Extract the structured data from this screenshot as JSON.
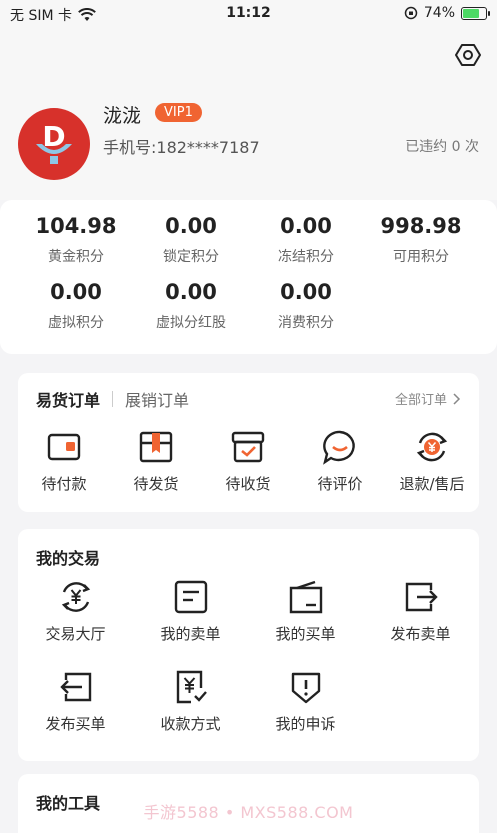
{
  "status_bar": {
    "carrier": "无 SIM 卡",
    "time": "11:12",
    "battery_percent": "74%",
    "battery_level": 0.74
  },
  "profile": {
    "avatar_letter": "D",
    "username": "泷泷",
    "vip_badge": "VIP1",
    "phone": "手机号:182****7187",
    "violations": "已违约 0 次"
  },
  "stats": [
    {
      "value": "104.98",
      "label": "黄金积分"
    },
    {
      "value": "0.00",
      "label": "锁定积分"
    },
    {
      "value": "0.00",
      "label": "冻结积分"
    },
    {
      "value": "998.98",
      "label": "可用积分"
    },
    {
      "value": "0.00",
      "label": "虚拟积分"
    },
    {
      "value": "0.00",
      "label": "虚拟分红股"
    },
    {
      "value": "0.00",
      "label": "消费积分"
    }
  ],
  "orders": {
    "tab_active": "易货订单",
    "tab_inactive": "展销订单",
    "all_orders": "全部订单",
    "items": [
      {
        "label": "待付款",
        "icon": "wallet-icon"
      },
      {
        "label": "待发货",
        "icon": "package-icon"
      },
      {
        "label": "待收货",
        "icon": "box-check-icon"
      },
      {
        "label": "待评价",
        "icon": "chat-icon"
      },
      {
        "label": "退款/售后",
        "icon": "refund-icon"
      }
    ]
  },
  "trade": {
    "title": "我的交易",
    "items": [
      {
        "label": "交易大厅",
        "icon": "yuan-exchange-icon"
      },
      {
        "label": "我的卖单",
        "icon": "document-icon"
      },
      {
        "label": "我的买单",
        "icon": "bill-icon"
      },
      {
        "label": "发布卖单",
        "icon": "exit-arrow-icon"
      },
      {
        "label": "发布买单",
        "icon": "enter-arrow-icon"
      },
      {
        "label": "收款方式",
        "icon": "receipt-icon"
      },
      {
        "label": "我的申诉",
        "icon": "shield-alert-icon"
      }
    ]
  },
  "tools": {
    "title": "我的工具"
  },
  "watermark": "手游5588 • MXS588.COM",
  "colors": {
    "accent": "#f06432",
    "avatar_bg": "#d7312b",
    "icon_orange": "#f06432"
  }
}
